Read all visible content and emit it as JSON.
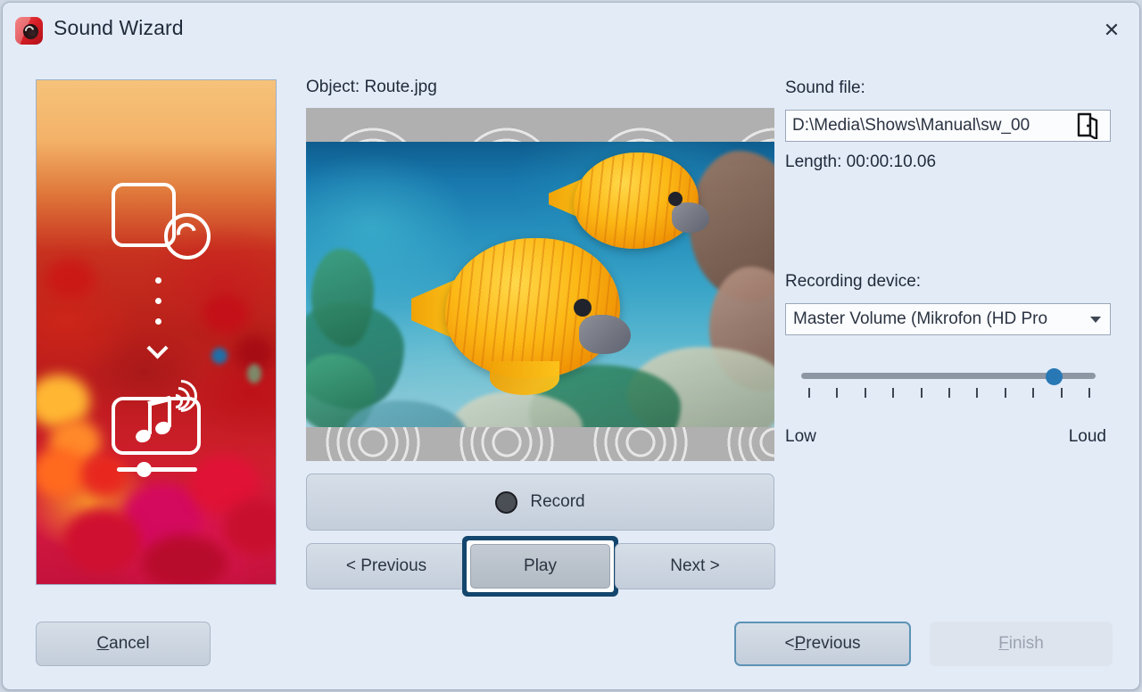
{
  "window": {
    "title": "Sound Wizard",
    "app_icon": "camera-lens-icon",
    "close_label": "✕"
  },
  "side_preview": {
    "name": "slide-preview-thumbnail",
    "overlay_top_icon": "image-icon",
    "overlay_arrow_icon": "dotted-arrow-down-icon",
    "overlay_bottom_icon": "sound-with-timeline-icon"
  },
  "center": {
    "object_label": "Object: Route.jpg",
    "preview_image_alt": "butterfly-fish-coral-reef",
    "record_label": "Record",
    "record_icon": "record-dot-icon",
    "previous_label": "< Previous",
    "play_label": "Play",
    "next_label": "Next >"
  },
  "right": {
    "sound_file_label": "Sound file:",
    "sound_file_value": "D:\\Media\\Shows\\Manual\\sw_00",
    "sound_file_placeholder": "",
    "browse_icon": "open-folder-icon",
    "length_label": "Length: 00:00:10.06",
    "recording_device_label": "Recording device:",
    "recording_device_value": "Master Volume (Mikrofon (HD Pro",
    "recording_device_caret": "chevron-down-icon",
    "volume_low_label": "Low",
    "volume_loud_label": "Loud",
    "volume_ticks": 11,
    "volume_percent": 88
  },
  "footer": {
    "cancel_label_pre": "",
    "cancel_accel": "C",
    "cancel_label_post": "ancel",
    "previous_label_pre": "< ",
    "previous_accel": "P",
    "previous_label_post": "revious",
    "finish_accel": "F",
    "finish_label_post": "inish"
  },
  "colors": {
    "dialog_bg": "#e3ebf7",
    "button_face": "#ccd5e0",
    "focus_ring": "#14466d",
    "default_button_border": "#5c93b5",
    "slider_thumb": "#2878b5",
    "slider_track": "#8d96a5",
    "text": "#1f2a3a",
    "disabled_text": "#9aa3b0"
  }
}
